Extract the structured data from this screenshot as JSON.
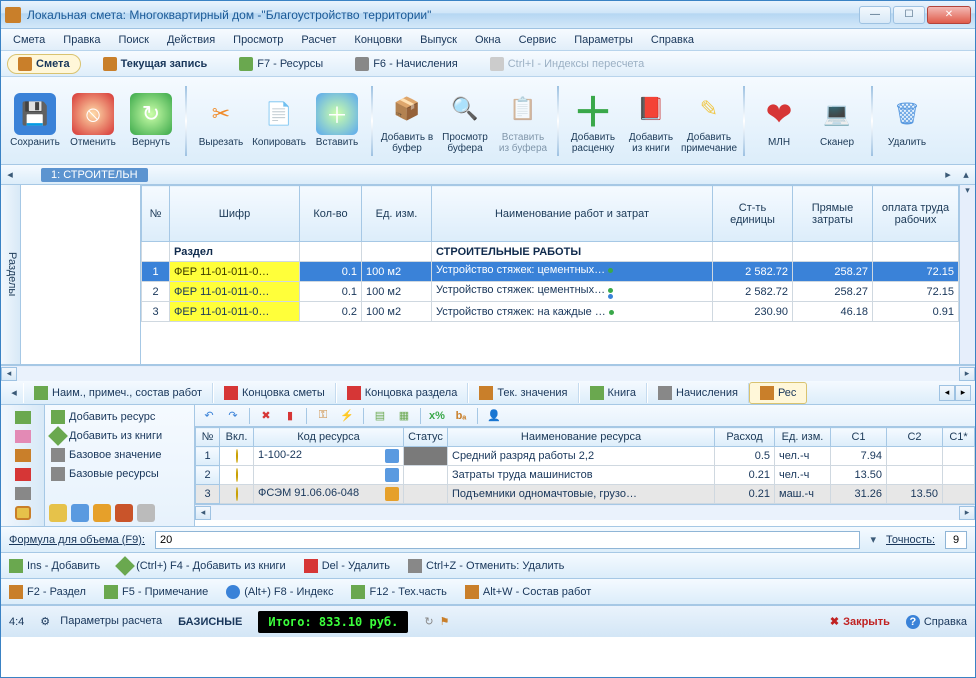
{
  "window": {
    "title": "Локальная смета: Многоквартирный дом -\"Благоустройство территории\""
  },
  "menu": [
    "Смета",
    "Правка",
    "Поиск",
    "Действия",
    "Просмотр",
    "Расчет",
    "Концовки",
    "Выпуск",
    "Окна",
    "Сервис",
    "Параметры",
    "Справка"
  ],
  "tabs1": [
    {
      "label": "Смета",
      "active": true,
      "icon_bg": "#c97f2a"
    },
    {
      "label": "Текущая запись",
      "active": false,
      "icon_bg": "#c97f2a"
    },
    {
      "label": "F7 - Ресурсы",
      "active": false,
      "icon_bg": "#6aa84f"
    },
    {
      "label": "F6 - Начисления",
      "active": false,
      "icon_bg": "#888"
    },
    {
      "label": "Ctrl+I - Индексы пересчета",
      "active": false,
      "icon_bg": "#bbb",
      "disabled": true
    }
  ],
  "bigtoolbar": [
    {
      "label": "Сохранить",
      "col": "#3a82d8",
      "glyph": "💾"
    },
    {
      "label": "Отменить",
      "col": "#d63636",
      "glyph": "⦸"
    },
    {
      "label": "Вернуть",
      "col": "#3aa84a",
      "glyph": "↻"
    },
    {
      "label": "Вырезать",
      "col": "#f08b2a",
      "glyph": "✂"
    },
    {
      "label": "Копировать",
      "col": "#f0c84a",
      "glyph": "📄"
    },
    {
      "label": "Вставить",
      "col": "#5aa8f0",
      "glyph": "＋"
    },
    {
      "label": "Добавить в буфер",
      "col": "#c97f2a",
      "glyph": "📦"
    },
    {
      "label": "Просмотр буфера",
      "col": "#5a9ae0",
      "glyph": "🔍"
    },
    {
      "label": "Вставить из буфера",
      "col": "#bbb",
      "glyph": "📋"
    },
    {
      "label": "Добавить расценку",
      "col": "#3aa84a",
      "glyph": "＋"
    },
    {
      "label": "Добавить из книги",
      "col": "#e08b2a",
      "glyph": "📕"
    },
    {
      "label": "Добавить примечание",
      "col": "#f0c84a",
      "glyph": "✎"
    },
    {
      "label": "МЛН",
      "col": "#d63636",
      "glyph": "❤"
    },
    {
      "label": "Сканер",
      "col": "#5a9ae0",
      "glyph": "💻"
    },
    {
      "label": "Удалить",
      "col": "#5a9ae0",
      "glyph": "🗑"
    }
  ],
  "section_chip": "1: СТРОИТЕЛЬН",
  "sidetab_label": "Разделы",
  "main_columns": [
    "№",
    "Шифр",
    "Кол-во",
    "Ед. изм.",
    "Наименование работ и затрат",
    "Ст-ть единицы",
    "Прямые затраты",
    "оплата труда рабочих"
  ],
  "main_section_label": "Раздел",
  "main_section_title": "СТРОИТЕЛЬНЫЕ РАБОТЫ",
  "main_rows": [
    {
      "n": "1",
      "code": "ФЕР 11-01-011-0…",
      "qty": "0.1",
      "unit": "100 м2",
      "name": "Устройство стяжек: цементных…",
      "unit_cost": "2 582.72",
      "direct": "258.27",
      "labor": "72.15",
      "selected": true
    },
    {
      "n": "2",
      "code": "ФЕР 11-01-011-0…",
      "qty": "0.1",
      "unit": "100 м2",
      "name": "Устройство стяжек: цементных…",
      "unit_cost": "2 582.72",
      "direct": "258.27",
      "labor": "72.15",
      "selected": false
    },
    {
      "n": "3",
      "code": "ФЕР 11-01-011-0…",
      "qty": "0.2",
      "unit": "100 м2",
      "name": "Устройство стяжек: на каждые …",
      "unit_cost": "230.90",
      "direct": "46.18",
      "labor": "0.91",
      "selected": false
    }
  ],
  "tabs2": [
    {
      "label": "Наим., примеч., состав работ",
      "icon": "#6aa84f"
    },
    {
      "label": "Концовка сметы",
      "icon": "#d63636"
    },
    {
      "label": "Концовка раздела",
      "icon": "#d63636"
    },
    {
      "label": "Тек. значения",
      "icon": "#c97f2a"
    },
    {
      "label": "Книга",
      "icon": "#6aa84f"
    },
    {
      "label": "Начисления",
      "icon": "#888"
    },
    {
      "label": "Рес",
      "icon": "#c97f2a",
      "active": true
    }
  ],
  "res_actions": [
    {
      "label": "Добавить ресурс",
      "icon": "#6aa84f"
    },
    {
      "label": "Добавить из книги",
      "icon": "#6aa84f"
    },
    {
      "label": "Базовое значение",
      "icon": "#888"
    },
    {
      "label": "Базовые ресурсы",
      "icon": "#888"
    }
  ],
  "res_toolbar_icons": [
    "↶",
    "↷",
    "",
    "✖",
    "📕",
    "",
    "🔑",
    "⚡",
    "",
    "📄",
    "📑",
    "",
    "x%",
    "bₐ",
    "",
    "👤"
  ],
  "res_columns": [
    "№",
    "Вкл.",
    "Код ресурса",
    "Статус",
    "Наименование ресурса",
    "Расход",
    "Ед. изм.",
    "С1",
    "С2",
    "С1*"
  ],
  "res_rows": [
    {
      "n": "1",
      "code": "1-100-22",
      "name": "Средний разряд работы 2,2",
      "rate": "0.5",
      "unit": "чел.-ч",
      "c1": "7.94",
      "c2": "",
      "gray": false
    },
    {
      "n": "2",
      "code": "",
      "name": "Затраты труда машинистов",
      "rate": "0.21",
      "unit": "чел.-ч",
      "c1": "13.50",
      "c2": "",
      "gray": false
    },
    {
      "n": "3",
      "code": "ФСЭМ 91.06.06-048",
      "name": "Подъемники одномачтовые, грузо…",
      "rate": "0.21",
      "unit": "маш.-ч",
      "c1": "31.26",
      "c2": "13.50",
      "gray": true
    }
  ],
  "formula": {
    "label": "Формула для объема (F9):",
    "value": "20",
    "acc_label": "Точность:",
    "acc_value": "9"
  },
  "actions_row1": [
    {
      "label": "Ins - Добавить",
      "icon": "#6aa84f"
    },
    {
      "label": "(Ctrl+) F4 - Добавить из книги",
      "icon": "#6aa84f"
    },
    {
      "label": "Del - Удалить",
      "icon": "#d63636"
    },
    {
      "label": "Ctrl+Z - Отменить: Удалить",
      "icon": "#888"
    }
  ],
  "actions_row2": [
    {
      "label": "F2 - Раздел",
      "icon": "#c97f2a"
    },
    {
      "label": "F5 - Примечание",
      "icon": "#6aa84f"
    },
    {
      "label": "(Alt+) F8 - Индекс",
      "icon": "#3a82d8"
    },
    {
      "label": "F12 - Тех.часть",
      "icon": "#6aa84f"
    },
    {
      "label": "Alt+W - Состав работ",
      "icon": "#c97f2a"
    }
  ],
  "status": {
    "pos": "4:4",
    "params_label": "Параметры расчета",
    "mode": "БАЗИСНЫЕ",
    "total": "Итого: 833.10 руб.",
    "close": "Закрыть",
    "help": "Справка"
  }
}
